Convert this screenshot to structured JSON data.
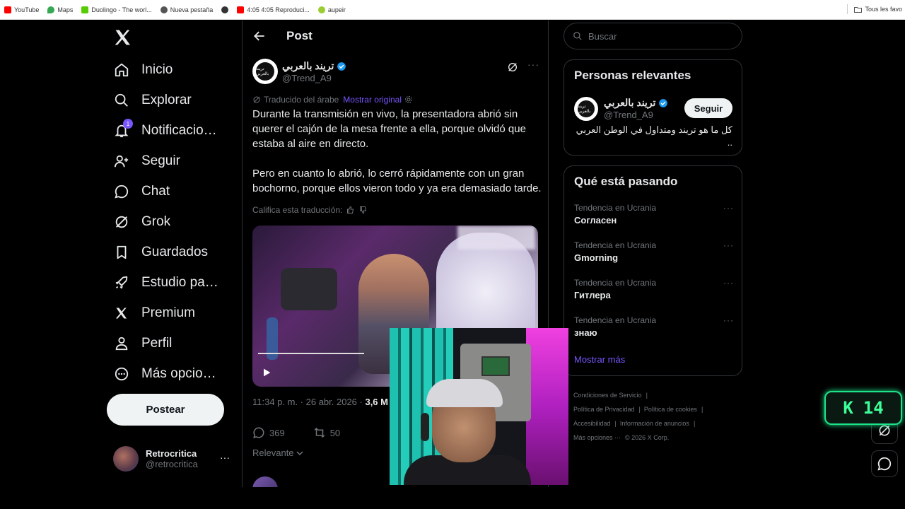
{
  "bookmarks": [
    {
      "label": "YouTube",
      "color": "#ff0000"
    },
    {
      "label": "Maps",
      "color": "#34a853"
    },
    {
      "label": "Duolingo - The worl...",
      "color": "#58cc02"
    },
    {
      "label": "Nueva pestaña",
      "color": "#555555"
    },
    {
      "label": "",
      "color": "#333333"
    },
    {
      "label": "4:05 4:05 Reproduci...",
      "color": "#ff0000"
    },
    {
      "label": "aupeir",
      "color": "#9acd32"
    }
  ],
  "bookmarks_right": "Tous les favo",
  "nav": {
    "items": [
      {
        "label": "Inicio",
        "icon": "home-icon"
      },
      {
        "label": "Explorar",
        "icon": "search-icon"
      },
      {
        "label": "Notificaciones",
        "icon": "bell-icon",
        "badge": "1"
      },
      {
        "label": "Seguir",
        "icon": "add-user-icon"
      },
      {
        "label": "Chat",
        "icon": "chat-icon"
      },
      {
        "label": "Grok",
        "icon": "grok-icon"
      },
      {
        "label": "Guardados",
        "icon": "bookmark-icon"
      },
      {
        "label": "Estudio para creadores",
        "icon": "rocket-icon"
      },
      {
        "label": "Premium",
        "icon": "x-icon"
      },
      {
        "label": "Perfil",
        "icon": "person-icon"
      },
      {
        "label": "Más opciones",
        "icon": "more-circle-icon"
      }
    ],
    "post_button": "Postear",
    "account": {
      "name": "Retrocritica",
      "handle": "@retrocritica",
      "more": "···"
    }
  },
  "post": {
    "header_title": "Post",
    "author": {
      "name": "تريند بالعربي",
      "handle": "@Trend_A9",
      "avatar_text": "تريند بالعربي"
    },
    "more": "···",
    "translated_label": "Traducido del árabe",
    "show_original": "Mostrar original",
    "paragraphs": [
      "Durante la transmisión en vivo, la presentadora abrió sin querer el cajón de la mesa frente a ella, porque olvidó que estaba al aire en directo.",
      "Pero en cuanto lo abrió, lo cerró rápidamente con un gran bochorno, porque ellos vieron todo y ya era demasiado tarde."
    ],
    "rate_translation": "Califica esta traducción:",
    "meta_time": "11:34 p. m. · 26 abr. 2026 · ",
    "meta_views": "3,6 M",
    "replies": "369",
    "reposts": "50",
    "sort_label": "Relevante"
  },
  "search": {
    "placeholder": "Buscar"
  },
  "relevant_people": {
    "title": "Personas relevantes",
    "name": "تريند بالعربي",
    "handle": "@Trend_A9",
    "follow": "Seguir",
    "bio": "كل ما هو تريند ومتداول في الوطن العربي .."
  },
  "trends": {
    "title": "Qué está pasando",
    "items": [
      {
        "context": "Tendencia en Ucrania",
        "name": "Согласен"
      },
      {
        "context": "Tendencia en Ucrania",
        "name": "Gmorning"
      },
      {
        "context": "Tendencia en Ucrania",
        "name": "Гитлера"
      },
      {
        "context": "Tendencia en Ucrania",
        "name": "знаю"
      }
    ],
    "more_label": "···",
    "show_more": "Mostrar más"
  },
  "footer": {
    "links": [
      "Condiciones de Servicio",
      "Política de Privacidad",
      "Política de cookies",
      "Accesibilidad",
      "Información de anuncios",
      "Más opciones ···",
      "© 2026 X Corp."
    ]
  },
  "badge_k14": {
    "letter": "K",
    "number": "14"
  },
  "colors": {
    "accent": "#7856ff",
    "verified": "#1d9bf0",
    "badge_green": "#1de38a"
  }
}
